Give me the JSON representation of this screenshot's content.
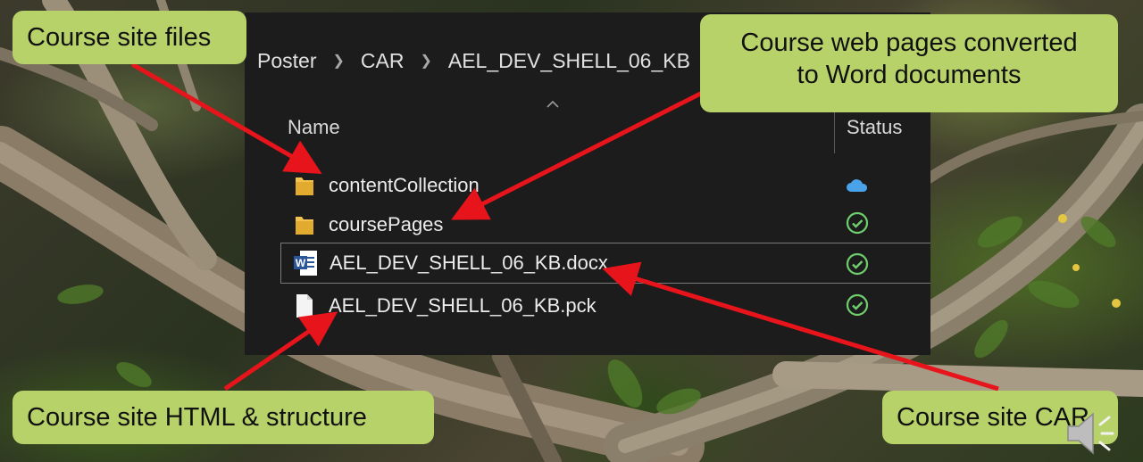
{
  "breadcrumb": [
    "Poster",
    "CAR",
    "AEL_DEV_SHELL_06_KB"
  ],
  "columns": {
    "name": "Name",
    "status": "Status"
  },
  "files": [
    {
      "name": "contentCollection",
      "icon": "folder-icon",
      "status": "cloud-icon"
    },
    {
      "name": "coursePages",
      "icon": "folder-icon",
      "status": "synced-check-icon"
    },
    {
      "name": "AEL_DEV_SHELL_06_KB.docx",
      "icon": "word-document-icon",
      "status": "synced-check-icon"
    },
    {
      "name": "AEL_DEV_SHELL_06_KB.pck",
      "icon": "blank-file-icon",
      "status": "synced-check-icon"
    }
  ],
  "callouts": {
    "site_files": "Course site files",
    "web_pages_line1": "Course web pages converted",
    "web_pages_line2": "to Word documents",
    "html_structure": "Course site HTML & structure",
    "site_car": "Course site CAR"
  },
  "colors": {
    "callout_bg": "#b8d26a",
    "arrow": "#e8141b",
    "explorer_bg": "#1c1c1c",
    "folder": "#f2c14e",
    "check": "#6fcf6f",
    "cloud": "#4aa3e8"
  }
}
